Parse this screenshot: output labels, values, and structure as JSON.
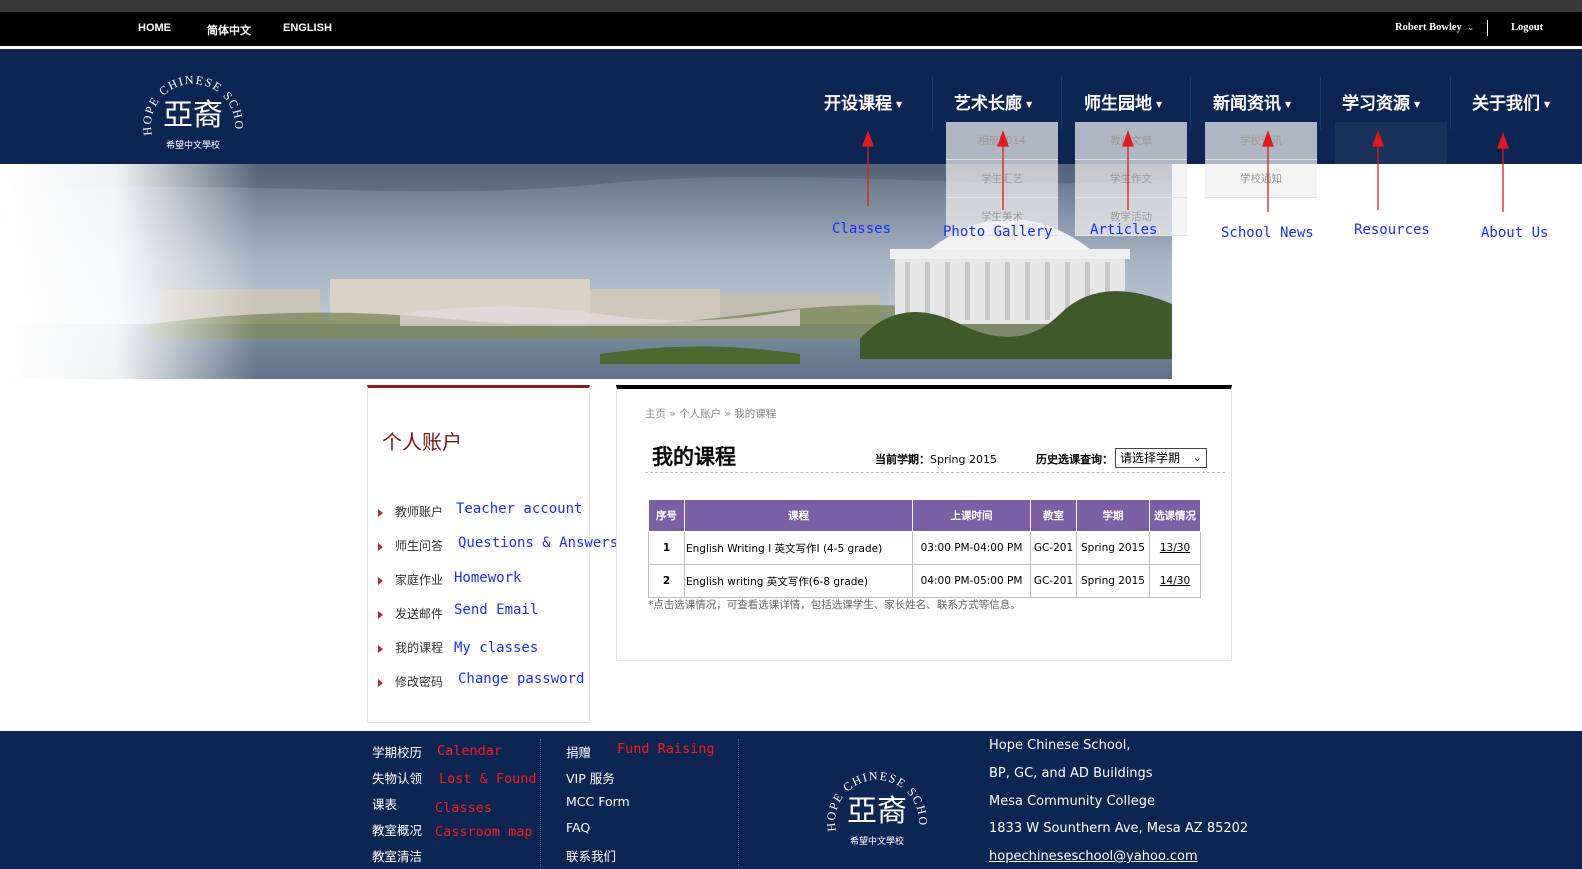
{
  "topbar": {
    "links": [
      "HOME",
      "简体中文",
      "ENGLISH"
    ],
    "user_name": "Robert Bowley",
    "logout": "Logout"
  },
  "logo": {
    "arc_text": "HOPE CHINESE SCHOOL",
    "main_glyphs": "亞裔",
    "sub_text": "希望中文學校"
  },
  "nav": {
    "items": [
      {
        "label": "开设课程"
      },
      {
        "label": "艺术长廊"
      },
      {
        "label": "师生园地"
      },
      {
        "label": "新闻资讯"
      },
      {
        "label": "学习资源"
      },
      {
        "label": "关于我们"
      }
    ],
    "dropdowns": {
      "gallery": [
        "相册2014",
        "学生汇艺",
        "学生美术"
      ],
      "articles": [
        "教师文章",
        "学生作文",
        "教学活动"
      ],
      "news": [
        "学校通讯",
        "学校通知"
      ]
    }
  },
  "annotations": {
    "nav": [
      "Classes",
      "Photo Gallery",
      "Articles",
      "School News",
      "Resources",
      "About Us"
    ],
    "sidebar": [
      "Teacher account",
      "Questions & Answers",
      "Homework",
      "Send Email",
      "My classes",
      "Change password"
    ],
    "footer": [
      "Calendar",
      "Lost & Found",
      "Classes",
      "Cassroom map",
      "Fund Raising"
    ]
  },
  "sidebar": {
    "title": "个人账户",
    "items": [
      "教师账户",
      "师生问答",
      "家庭作业",
      "发送邮件",
      "我的课程",
      "修改密码"
    ]
  },
  "main": {
    "breadcrumb": "主页 » 个人账户 » 我的课程",
    "title": "我的课程",
    "current_term_label": "当前学期：",
    "current_term_value": "Spring 2015",
    "history_label": "历史选课查询：",
    "history_select": "请选择学期",
    "table": {
      "headers": [
        "序号",
        "课程",
        "上课时间",
        "教室",
        "学期",
        "选课情况"
      ],
      "rows": [
        [
          "1",
          "English Writing I 英文写作I (4-5 grade)",
          "03:00 PM-04:00 PM",
          "GC-201",
          "Spring 2015",
          "13/30"
        ],
        [
          "2",
          "English writing 英文写作(6-8 grade)",
          "04:00 PM-05:00 PM",
          "GC-201",
          "Spring 2015",
          "14/30"
        ]
      ]
    },
    "note": "*点击选课情况，可查看选课详情，包括选课学生、家长姓名、联系方式等信息。"
  },
  "footer": {
    "col1": [
      "学期校历",
      "失物认领",
      "课表",
      "教室概况",
      "教室清洁"
    ],
    "col2": [
      "捐赠",
      "VIP 服务",
      "MCC Form",
      "FAQ",
      "联系我们"
    ],
    "address": [
      "Hope Chinese School,",
      "BP, GC, and AD Buildings",
      "Mesa Community College",
      "1833 W Sounthern Ave, Mesa AZ 85202",
      "hopechineseschool@yahoo.com"
    ]
  }
}
